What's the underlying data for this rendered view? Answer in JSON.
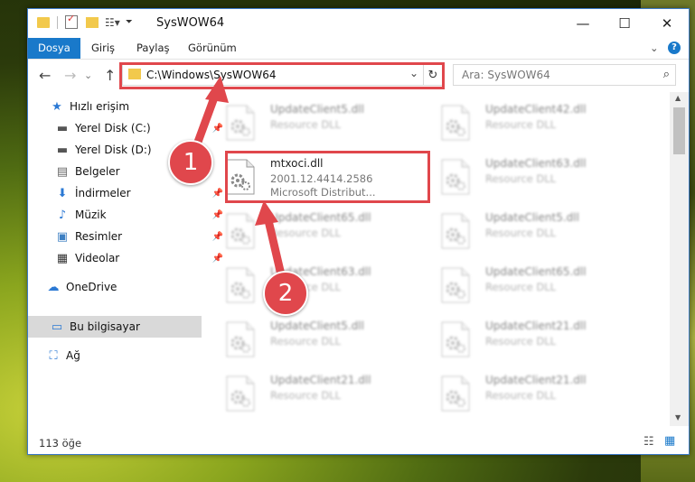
{
  "window": {
    "title": "SysWOW64",
    "controls": {
      "minimize": "—",
      "maximize": "☐",
      "close": "✕"
    }
  },
  "ribbon": {
    "tabs": [
      "Dosya",
      "Giriş",
      "Paylaş",
      "Görünüm"
    ],
    "collapse": "⌄",
    "help": "?"
  },
  "navigation": {
    "back": "←",
    "forward": "→",
    "dropdown": "⌄",
    "up": "↑",
    "address": "C:\\Windows\\SysWOW64",
    "address_dropdown": "⌄",
    "refresh": "↻",
    "search_placeholder": "Ara: SysWOW64",
    "search_icon": "⌕"
  },
  "sidebar": {
    "items": [
      {
        "label": "Hızlı erişim",
        "icon": "star-icon",
        "glyph": "★",
        "color": "#2b79d4"
      },
      {
        "label": "Yerel Disk (C:)",
        "icon": "drive-icon",
        "glyph": "▬",
        "color": "#555555",
        "pinned": "📌"
      },
      {
        "label": "Yerel Disk (D:)",
        "icon": "drive-icon",
        "glyph": "▬",
        "color": "#555555"
      },
      {
        "label": "Belgeler",
        "icon": "documents-icon",
        "glyph": "▤",
        "color": "#666666"
      },
      {
        "label": "İndirmeler",
        "icon": "download-icon",
        "glyph": "⬇",
        "color": "#2b79d4",
        "pinned": "📌"
      },
      {
        "label": "Müzik",
        "icon": "music-icon",
        "glyph": "♪",
        "color": "#2b79d4",
        "pinned": "📌"
      },
      {
        "label": "Resimler",
        "icon": "pictures-icon",
        "glyph": "▣",
        "color": "#3d7fc2",
        "pinned": "📌"
      },
      {
        "label": "Videolar",
        "icon": "videos-icon",
        "glyph": "▦",
        "color": "#333333",
        "pinned": "📌"
      },
      {
        "label": "OneDrive",
        "icon": "cloud-icon",
        "glyph": "☁",
        "color": "#2b79d4"
      },
      {
        "label": "Bu bilgisayar",
        "icon": "computer-icon",
        "glyph": "▭",
        "color": "#2b79d4"
      },
      {
        "label": "Ağ",
        "icon": "network-icon",
        "glyph": "⛶",
        "color": "#2b79d4"
      }
    ]
  },
  "files": {
    "left": [
      {
        "name": "UpdateClient5.dll",
        "sub": "Resource DLL"
      },
      {
        "name": "mtxoci.dll",
        "version": "2001.12.4414.2586",
        "company": "Microsoft Distribut..."
      },
      {
        "name": "UpdateClient65.dll",
        "sub": "Resource DLL"
      },
      {
        "name": "UpdateClient63.dll",
        "sub": "Resource DLL"
      },
      {
        "name": "UpdateClient5.dll",
        "sub": "Resource DLL"
      },
      {
        "name": "UpdateClient21.dll",
        "sub": "Resource DLL"
      }
    ],
    "right": [
      {
        "name": "UpdateClient42.dll",
        "sub": "Resource DLL"
      },
      {
        "name": "UpdateClient63.dll",
        "sub": "Resource DLL"
      },
      {
        "name": "UpdateClient5.dll",
        "sub": "Resource DLL"
      },
      {
        "name": "UpdateClient65.dll",
        "sub": "Resource DLL"
      },
      {
        "name": "UpdateClient21.dll",
        "sub": "Resource DLL"
      },
      {
        "name": "UpdateClient21.dll",
        "sub": "Resource DLL"
      }
    ]
  },
  "status": {
    "count": "113 öğe",
    "details_view": "☷",
    "tiles_view": "▦"
  },
  "annotations": {
    "badge1": "1",
    "badge2": "2",
    "accent": "#e0474c"
  },
  "scrollbar": {
    "up": "▲",
    "down": "▼"
  }
}
